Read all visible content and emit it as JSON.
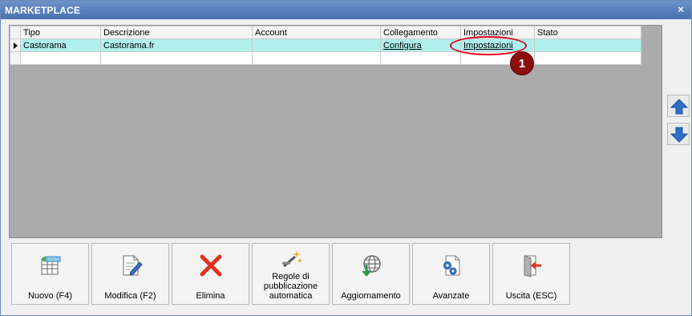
{
  "window": {
    "title": "MARKETPLACE",
    "close_glyph": "×"
  },
  "grid": {
    "columns": [
      "Tipo",
      "Descrizione",
      "Account",
      "Collegamento",
      "Impostazioni",
      "Stato"
    ],
    "rows": [
      {
        "tipo": "Castorama",
        "descrizione": "Castorama.fr",
        "account": "",
        "collegamento": "Configura",
        "impostazioni": "Impostazioni",
        "stato": ""
      }
    ],
    "active_row_color": "#aff0ef"
  },
  "callout": {
    "number": "1",
    "color": "#e3001b"
  },
  "side_buttons": {
    "up_icon": "arrow-up-icon",
    "down_icon": "arrow-down-icon"
  },
  "toolbar": {
    "nuovo": "Nuovo (F4)",
    "modifica": "Modifica (F2)",
    "elimina": "Elimina",
    "regole": "Regole di\npubblicazione\nautomatica",
    "aggiornamento": "Aggiornamento",
    "avanzate": "Avanzate",
    "uscita": "Uscita (ESC)"
  }
}
